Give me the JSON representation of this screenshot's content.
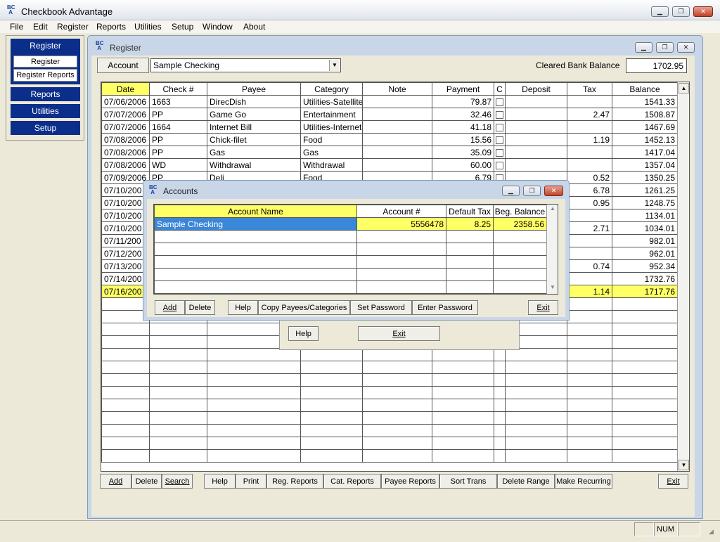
{
  "app": {
    "title": "Checkbook Advantage"
  },
  "menu": [
    "File",
    "Edit",
    "Register",
    "Reports",
    "Utilities",
    "Setup",
    "Window",
    "About"
  ],
  "sidebar": {
    "register_header": "Register",
    "register": "Register",
    "register_reports": "Register Reports",
    "reports": "Reports",
    "utilities": "Utilities",
    "setup": "Setup"
  },
  "register": {
    "title": "Register",
    "account_label": "Account",
    "account_value": "Sample Checking",
    "cleared_label": "Cleared Bank Balance",
    "cleared_value": "1702.95",
    "columns": [
      "Date",
      "Check #",
      "Payee",
      "Category",
      "Note",
      "Payment",
      "C",
      "Deposit",
      "Tax",
      "Balance"
    ],
    "rows": [
      [
        "07/06/2006",
        "1663",
        "DirecDish",
        "Utilities-Satellite",
        "",
        "79.87",
        "",
        "",
        "",
        "1541.33"
      ],
      [
        "07/07/2006",
        "PP",
        "Game Go",
        "Entertainment",
        "",
        "32.46",
        "",
        "",
        "2.47",
        "1508.87"
      ],
      [
        "07/07/2006",
        "1664",
        "Internet Bill",
        "Utilities-Internet",
        "",
        "41.18",
        "",
        "",
        "",
        "1467.69"
      ],
      [
        "07/08/2006",
        "PP",
        "Chick-filet",
        "Food",
        "",
        "15.56",
        "",
        "",
        "1.19",
        "1452.13"
      ],
      [
        "07/08/2006",
        "PP",
        "Gas",
        "Gas",
        "",
        "35.09",
        "",
        "",
        "",
        "1417.04"
      ],
      [
        "07/08/2006",
        "WD",
        "Withdrawal",
        "Withdrawal",
        "",
        "60.00",
        "",
        "",
        "",
        "1357.04"
      ],
      [
        "07/09/2006",
        "PP",
        "Deli",
        "Food",
        "",
        "6.79",
        "",
        "",
        "0.52",
        "1350.25"
      ],
      [
        "07/10/200",
        "",
        "",
        "",
        "",
        "",
        "",
        "",
        "6.78",
        "1261.25"
      ],
      [
        "07/10/200",
        "",
        "",
        "",
        "",
        "",
        "",
        "",
        "0.95",
        "1248.75"
      ],
      [
        "07/10/200",
        "",
        "",
        "",
        "",
        "",
        "",
        "",
        "",
        "1134.01"
      ],
      [
        "07/10/200",
        "",
        "",
        "",
        "",
        "",
        "",
        "",
        "2.71",
        "1034.01"
      ],
      [
        "07/11/200",
        "",
        "",
        "",
        "",
        "",
        "",
        "",
        "",
        "982.01"
      ],
      [
        "07/12/200",
        "",
        "",
        "",
        "",
        "",
        "",
        "",
        "",
        "962.01"
      ],
      [
        "07/13/200",
        "",
        "",
        "",
        "",
        "",
        "",
        "",
        "0.74",
        "952.34"
      ],
      [
        "07/14/200",
        "",
        "",
        "",
        "",
        "",
        "",
        "",
        "",
        "1732.76"
      ],
      [
        "07/16/200",
        "",
        "",
        "",
        "",
        "",
        "",
        "",
        "1.14",
        "1717.76"
      ]
    ],
    "buttons": [
      "Add",
      "Delete",
      "Search",
      "Help",
      "Print",
      "Reg. Reports",
      "Cat. Reports",
      "Payee Reports",
      "Sort Trans",
      "Delete Range",
      "Make Recurring",
      "Exit"
    ]
  },
  "hidden_dialog": {
    "help": "Help",
    "exit": "Exit"
  },
  "accounts": {
    "title": "Accounts",
    "columns": [
      "Account Name",
      "Account #",
      "Default Tax",
      "Beg. Balance"
    ],
    "rows": [
      [
        "Sample Checking",
        "5556478",
        "8.25",
        "2358.56"
      ]
    ],
    "buttons": [
      "Add",
      "Delete",
      "Help",
      "Copy Payees/Categories",
      "Set Password",
      "Enter Password",
      "Exit"
    ]
  },
  "status": {
    "num": "NUM"
  },
  "colors": {
    "header_blue": "#0b2e8a",
    "highlight_yellow": "#ffff66",
    "select_blue": "#3a86d8"
  }
}
